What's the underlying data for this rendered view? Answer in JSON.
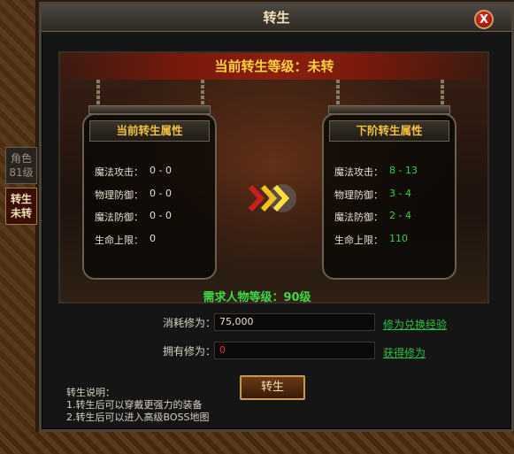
{
  "window": {
    "title": "转生",
    "close_label": "X"
  },
  "side_tabs": [
    {
      "line1": "角色",
      "line2": "81级"
    },
    {
      "line1": "转生",
      "line2": "未转"
    }
  ],
  "banner": "当前转生等级：未转",
  "current": {
    "title": "当前转生属性",
    "stats": [
      {
        "label": "魔法攻击：",
        "value": "0 - 0"
      },
      {
        "label": "物理防御：",
        "value": "0 - 0"
      },
      {
        "label": "魔法防御：",
        "value": "0 - 0"
      },
      {
        "label": "生命上限：",
        "value": "0"
      }
    ]
  },
  "next": {
    "title": "下阶转生属性",
    "stats": [
      {
        "label": "魔法攻击：",
        "value": "8 - 13"
      },
      {
        "label": "物理防御：",
        "value": "3 - 4"
      },
      {
        "label": "魔法防御：",
        "value": "2 - 4"
      },
      {
        "label": "生命上限：",
        "value": "110"
      }
    ]
  },
  "requirement": "需求人物等级：90级",
  "cost": {
    "label": "消耗修为：",
    "value": "75,000",
    "link": "修为兑换经验"
  },
  "owned": {
    "label": "拥有修为：",
    "value": "0",
    "link": "获得修为"
  },
  "action_button": "转生",
  "notes": {
    "title": "转生说明：",
    "lines": [
      "1.转生后可以穿戴更强力的装备",
      "2.转生后可以进入高级BOSS地图"
    ]
  },
  "colors": {
    "accent_gold": "#ffd040",
    "stat_green": "#38d040",
    "owned_red": "#e03030"
  }
}
